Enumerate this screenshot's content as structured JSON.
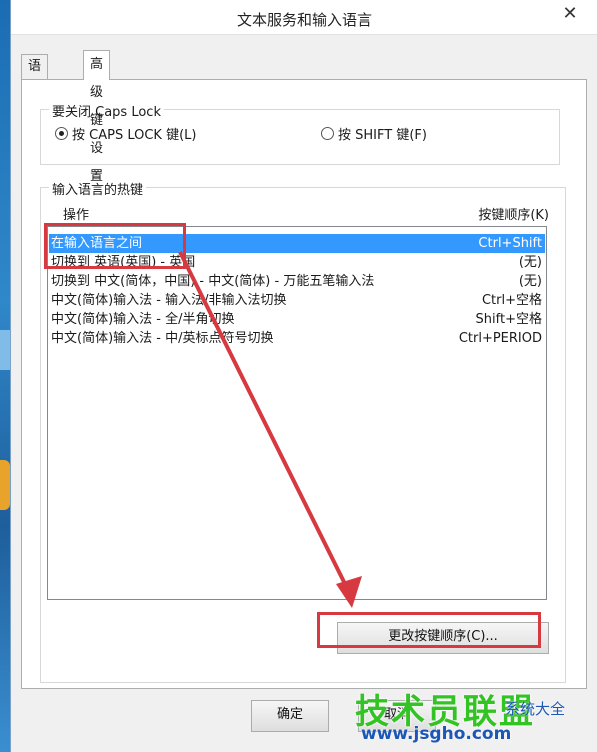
{
  "window": {
    "title": "文本服务和输入语言",
    "close_glyph": "✕"
  },
  "tabs": [
    {
      "label": "语言栏",
      "active": false
    },
    {
      "label": "高级键设置",
      "active": true
    }
  ],
  "caps_group": {
    "legend": "要关闭 Caps Lock",
    "options": [
      {
        "label": "按 CAPS LOCK 键(L)",
        "checked": true
      },
      {
        "label": "按 SHIFT 键(F)",
        "checked": false
      }
    ]
  },
  "hotkeys": {
    "legend": "输入语言的热键",
    "col_action": "操作",
    "col_keys": "按键顺序(K)",
    "rows": [
      {
        "action": "在输入语言之间",
        "keys": "Ctrl+Shift",
        "selected": true
      },
      {
        "action": "切换到 英语(英国) - 英国",
        "keys": "(无)",
        "selected": false
      },
      {
        "action": "切换到 中文(简体，中国) - 中文(简体) - 万能五笔输入法",
        "keys": "(无)",
        "selected": false
      },
      {
        "action": "中文(简体)输入法 - 输入法/非输入法切换",
        "keys": "Ctrl+空格",
        "selected": false
      },
      {
        "action": "中文(简体)输入法 - 全/半角切换",
        "keys": "Shift+空格",
        "selected": false
      },
      {
        "action": "中文(简体)输入法 - 中/英标点符号切换",
        "keys": "Ctrl+PERIOD",
        "selected": false
      }
    ],
    "change_button": "更改按键顺序(C)..."
  },
  "footer": {
    "ok": "确定",
    "cancel": "取消"
  },
  "watermark": {
    "main": "技术员联盟",
    "url": "www.jsgho.com",
    "badge": "系统大全"
  },
  "colors": {
    "selection": "#3399ff",
    "annotation": "#d6393f"
  }
}
